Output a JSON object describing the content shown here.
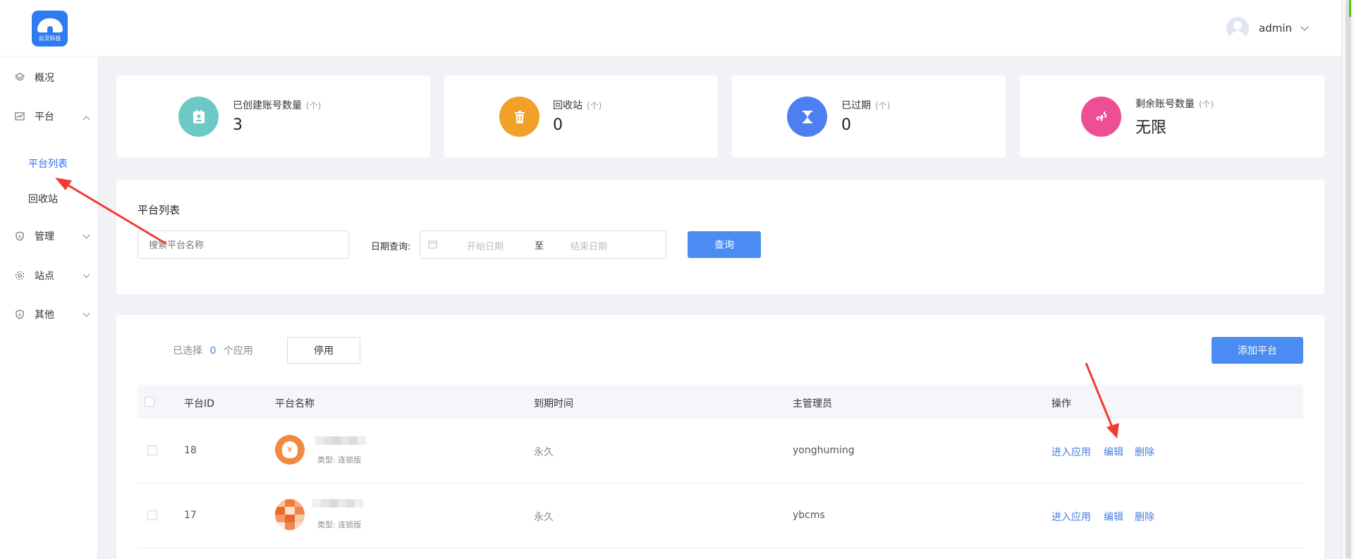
{
  "header": {
    "logo_text": "云灵科技",
    "username": "admin"
  },
  "sidebar": {
    "items": [
      {
        "label": "概况"
      },
      {
        "label": "平台"
      },
      {
        "label": "管理"
      },
      {
        "label": "站点"
      },
      {
        "label": "其他"
      }
    ],
    "sub_items": [
      {
        "label": "平台列表",
        "active": true
      },
      {
        "label": "回收站",
        "active": false
      }
    ]
  },
  "stats": [
    {
      "label": "已创建账号数量",
      "unit": "(个)",
      "value": "3",
      "color": "#6cc9c6",
      "icon": "badge-icon"
    },
    {
      "label": "回收站",
      "unit": "(个)",
      "value": "0",
      "color": "#f1a12a",
      "icon": "trash-icon"
    },
    {
      "label": "已过期",
      "unit": "(个)",
      "value": "0",
      "color": "#4d7ff0",
      "icon": "hourglass-icon"
    },
    {
      "label": "剩余账号数量",
      "unit": "(个)",
      "value": "无限",
      "color": "#ee4e95",
      "icon": "link-icon"
    }
  ],
  "filter": {
    "title": "平台列表",
    "search_placeholder": "搜索平台名称",
    "date_label": "日期查询:",
    "start_placeholder": "开始日期",
    "separator": "至",
    "end_placeholder": "结束日期",
    "query_button": "查询"
  },
  "table_toolbar": {
    "selected_prefix": "已选择",
    "selected_count": "0",
    "selected_suffix": "个应用",
    "disable_button": "停用",
    "add_button": "添加平台"
  },
  "table": {
    "headers": [
      "平台ID",
      "平台名称",
      "到期时间",
      "主管理员",
      "操作"
    ],
    "rows": [
      {
        "id": "18",
        "type": "类型:  连锁版",
        "expiry": "永久",
        "admin": "yonghuming",
        "actions": [
          "进入应用",
          "编辑",
          "删除"
        ]
      },
      {
        "id": "17",
        "type": "类型:  连锁版",
        "expiry": "永久",
        "admin": "ybcms",
        "actions": [
          "进入应用",
          "编辑",
          "删除"
        ]
      }
    ]
  },
  "colors": {
    "accent": "#4a8cf1",
    "link": "#4a7fd8",
    "annotation_arrow": "#f23b31"
  }
}
